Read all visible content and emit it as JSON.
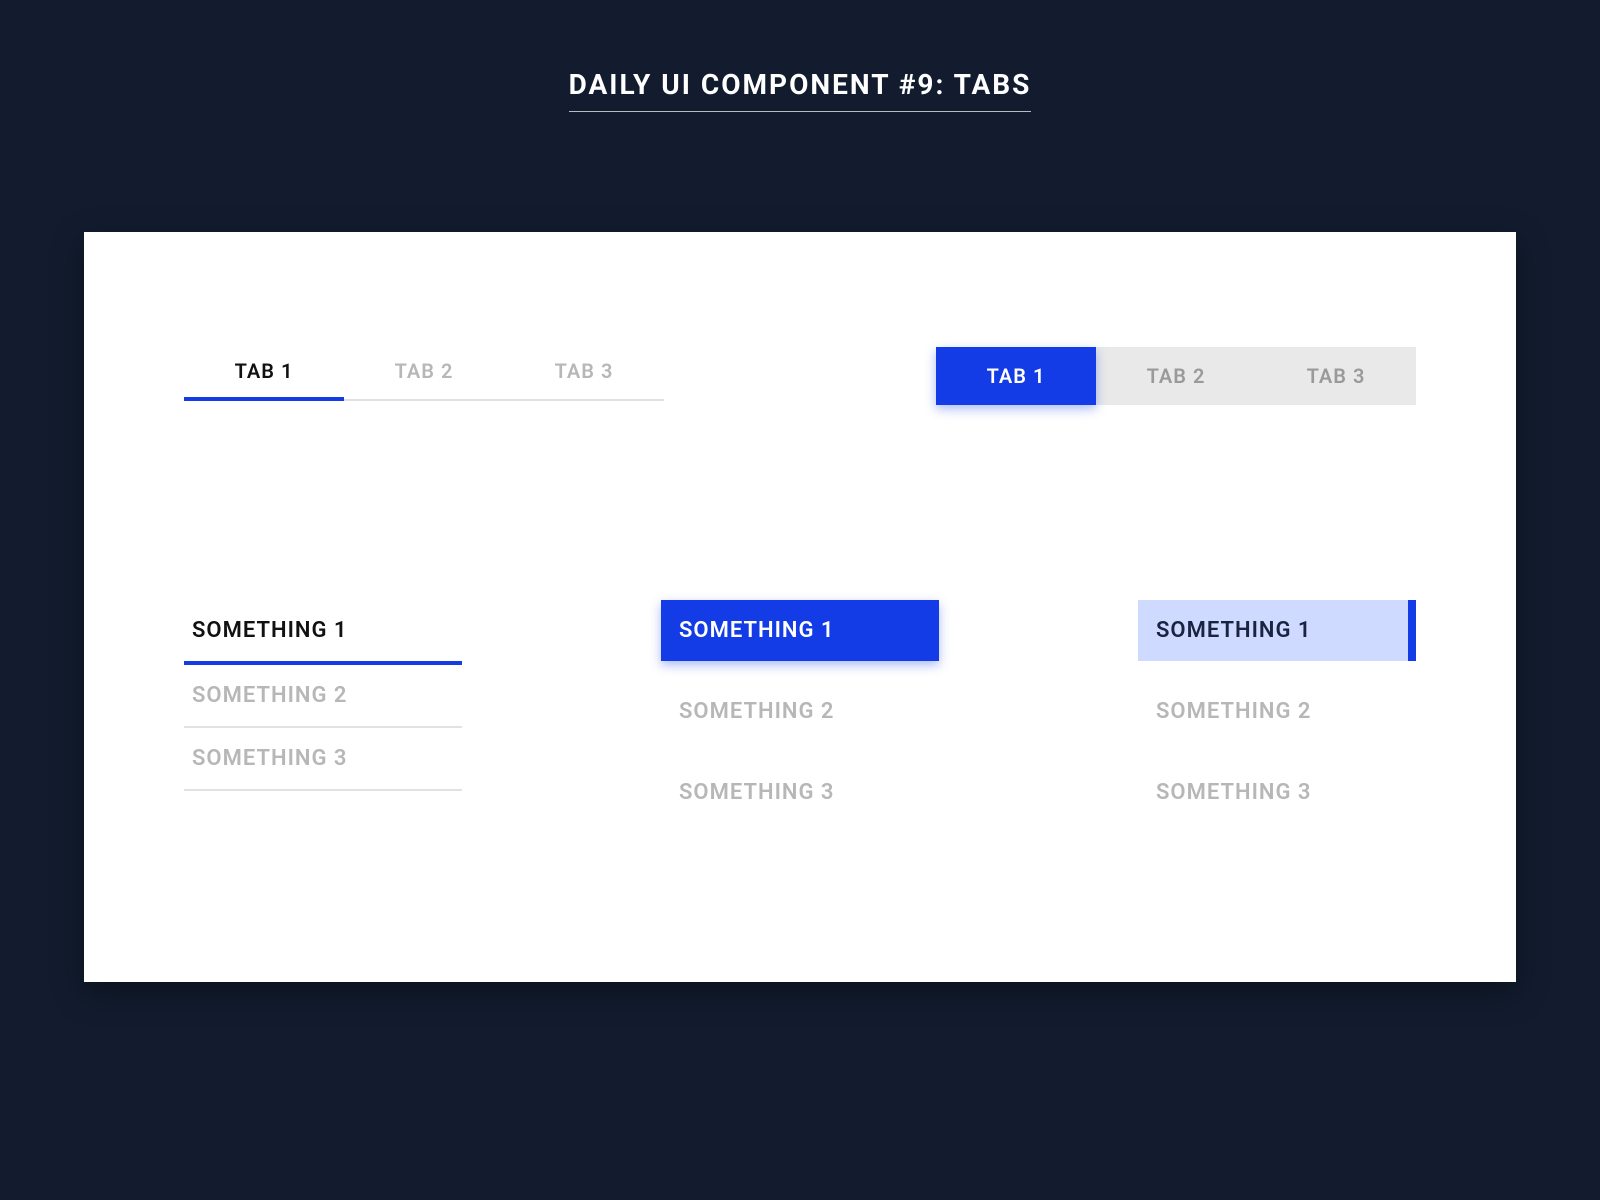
{
  "title": "DAILY UI COMPONENT #9: TABS",
  "colors": {
    "bg": "#121c2e",
    "accent": "#133ce6",
    "accentLight": "#cedaff",
    "muted": "#b7b7b7"
  },
  "groupA": {
    "tabs": [
      {
        "label": "TAB 1",
        "active": true
      },
      {
        "label": "TAB 2",
        "active": false
      },
      {
        "label": "TAB 3",
        "active": false
      }
    ]
  },
  "groupB": {
    "tabs": [
      {
        "label": "TAB 1",
        "active": true
      },
      {
        "label": "TAB 2",
        "active": false
      },
      {
        "label": "TAB 3",
        "active": false
      }
    ]
  },
  "groupC": {
    "tabs": [
      {
        "label": "SOMETHING 1",
        "active": true
      },
      {
        "label": "SOMETHING 2",
        "active": false
      },
      {
        "label": "SOMETHING 3",
        "active": false
      }
    ]
  },
  "groupD": {
    "tabs": [
      {
        "label": "SOMETHING 1",
        "active": true
      },
      {
        "label": "SOMETHING 2",
        "active": false
      },
      {
        "label": "SOMETHING 3",
        "active": false
      }
    ]
  },
  "groupE": {
    "tabs": [
      {
        "label": "SOMETHING 1",
        "active": true
      },
      {
        "label": "SOMETHING 2",
        "active": false
      },
      {
        "label": "SOMETHING 3",
        "active": false
      }
    ]
  }
}
